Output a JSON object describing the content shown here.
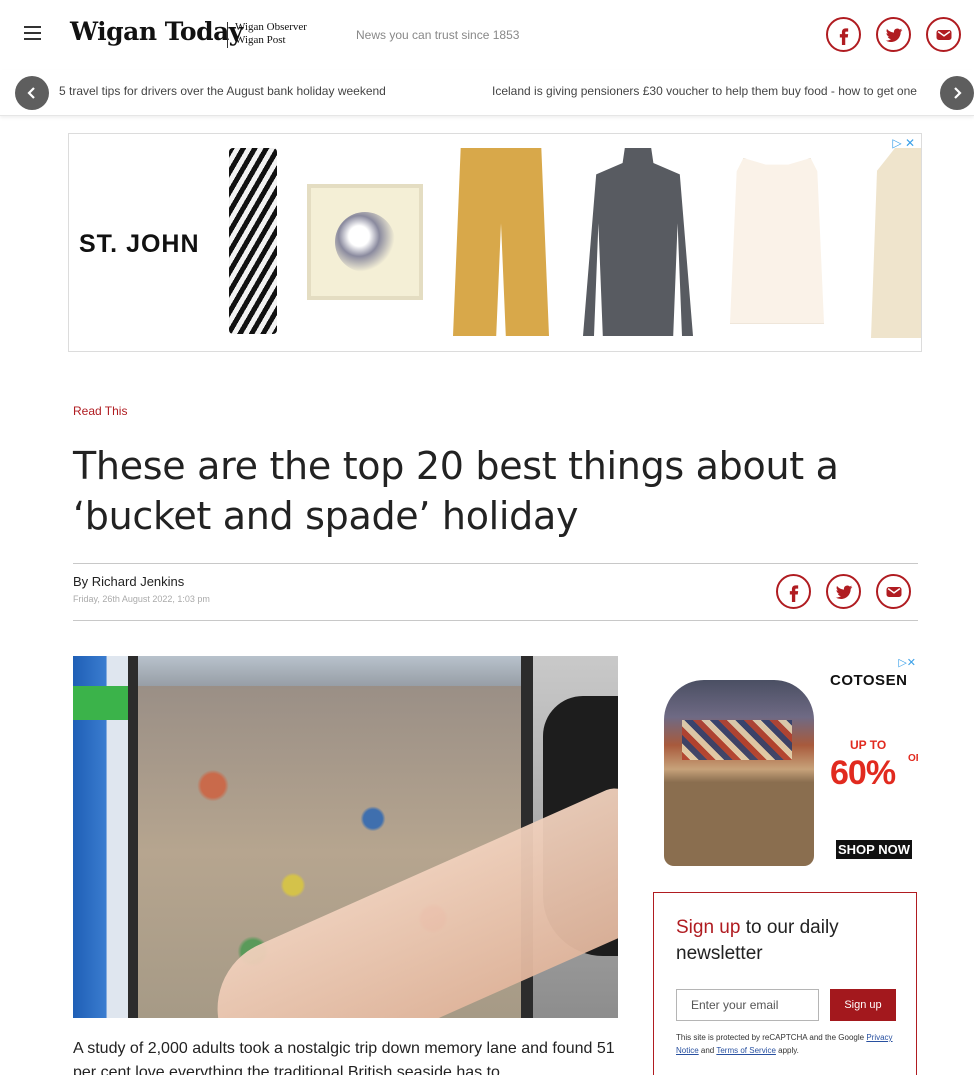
{
  "header": {
    "logo": "Wigan Today",
    "logo_sub_1": "Wigan Observer",
    "logo_sub_2": "Wigan Post",
    "tagline": "News you can trust since 1853",
    "social_icons": [
      "facebook-icon",
      "twitter-icon",
      "email-icon"
    ]
  },
  "ticker": {
    "items": [
      "5 travel tips for drivers over the August bank holiday weekend",
      "Iceland is giving pensioners £30 voucher to help them buy food - how to get one"
    ]
  },
  "ad_top": {
    "brand": "ST. JOHN"
  },
  "article": {
    "kicker": "Read This",
    "headline": "These are the top 20 best things about a ‘bucket and spade’ holiday",
    "author": "By Richard Jenkins",
    "date": "Friday, 26th August 2022, 1:03 pm",
    "body_start": "A study of 2,000 adults took a nostalgic trip down memory lane and found 51 per cent love everything the traditional British seaside has to"
  },
  "ad_right": {
    "brand": "COTOSEN",
    "up_to": "UP TO",
    "percent": "60%",
    "off": "OFF",
    "cta": "SHOP NOW"
  },
  "newsletter": {
    "title_red": "Sign up",
    "title_rest": " to our daily newsletter",
    "input_placeholder": "Enter your email",
    "button": "Sign up",
    "legal_1": "This site is protected by reCAPTCHA and the Google ",
    "privacy_link": "Privacy Notice",
    "legal_and": " and ",
    "terms_link": "Terms of Service",
    "legal_end": " apply."
  },
  "colors": {
    "brand_red": "#b01c21",
    "ticker_button": "#5e5e5e",
    "ad_red": "#e12a1f"
  }
}
